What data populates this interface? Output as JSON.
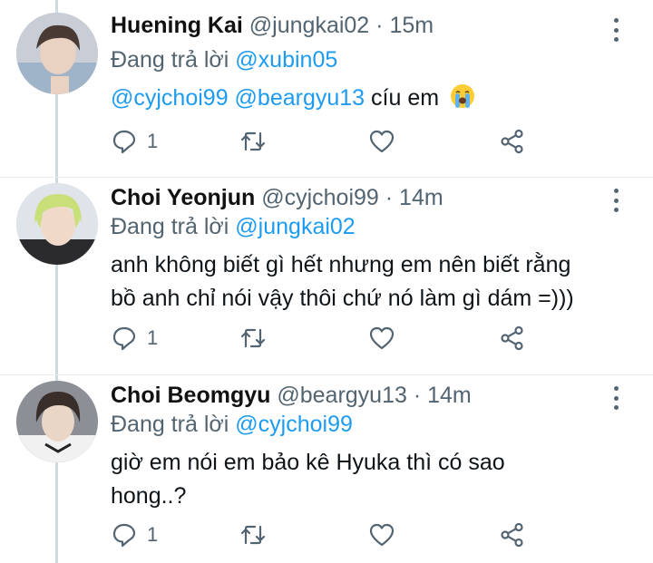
{
  "replying_prefix": "Đang trả lời",
  "tweets": [
    {
      "name": "Huening Kai",
      "handle": "@jungkai02",
      "time": "· 15m",
      "replying_to": "@xubin05",
      "body_mentions": "@cyjchoi99 @beargyu13",
      "body_text": " cíu em",
      "emoji": "loudly-crying-face",
      "reply_count": "1"
    },
    {
      "name": "Choi Yeonjun",
      "handle": "@cyjchoi99",
      "time": "· 14m",
      "replying_to": "@jungkai02",
      "body_line1": "anh không biết gì hết nhưng em nên biết rằng",
      "body_line2": "bồ anh chỉ nói vậy thôi chứ nó làm gì dám =)))",
      "reply_count": "1"
    },
    {
      "name": "Choi Beomgyu",
      "handle": "@beargyu13",
      "time": "· 14m",
      "replying_to": "@cyjchoi99",
      "body_line1": "giờ em nói em bảo kê Hyuka thì có sao",
      "body_line2": "hong..?",
      "reply_count": "1"
    }
  ],
  "colors": {
    "link": "#1d9bf0",
    "muted": "#536471",
    "thread_line": "#cfd9de"
  },
  "icons": [
    "reply-icon",
    "retweet-icon",
    "like-icon",
    "share-icon",
    "more-options-icon"
  ]
}
